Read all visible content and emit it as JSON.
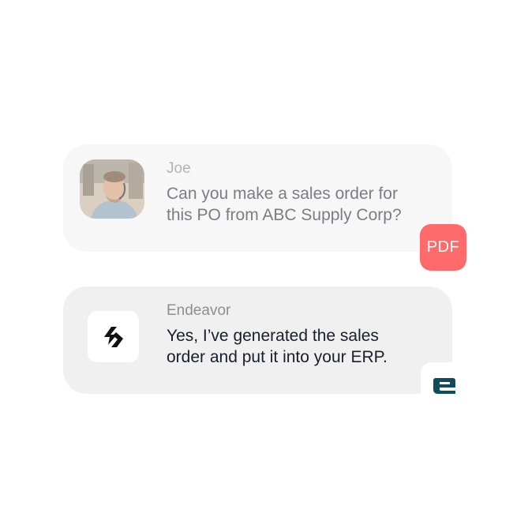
{
  "conversation": {
    "messages": [
      {
        "sender": "Joe",
        "text": "Can you make a sales order for\nthis PO from ABC Supply Corp?",
        "avatar_icon": "user-photo"
      },
      {
        "sender": "Endeavor",
        "text": "Yes, I’ve generated the sales\norder and put it into your ERP.",
        "avatar_icon": "endeavor-logo-icon"
      }
    ]
  },
  "attachments": {
    "pdf_label": "PDF",
    "erp_icon": "endeavor-e-icon"
  },
  "colors": {
    "pdf_badge": "#ff6b6b",
    "brand_teal": "#0f4c5c"
  }
}
